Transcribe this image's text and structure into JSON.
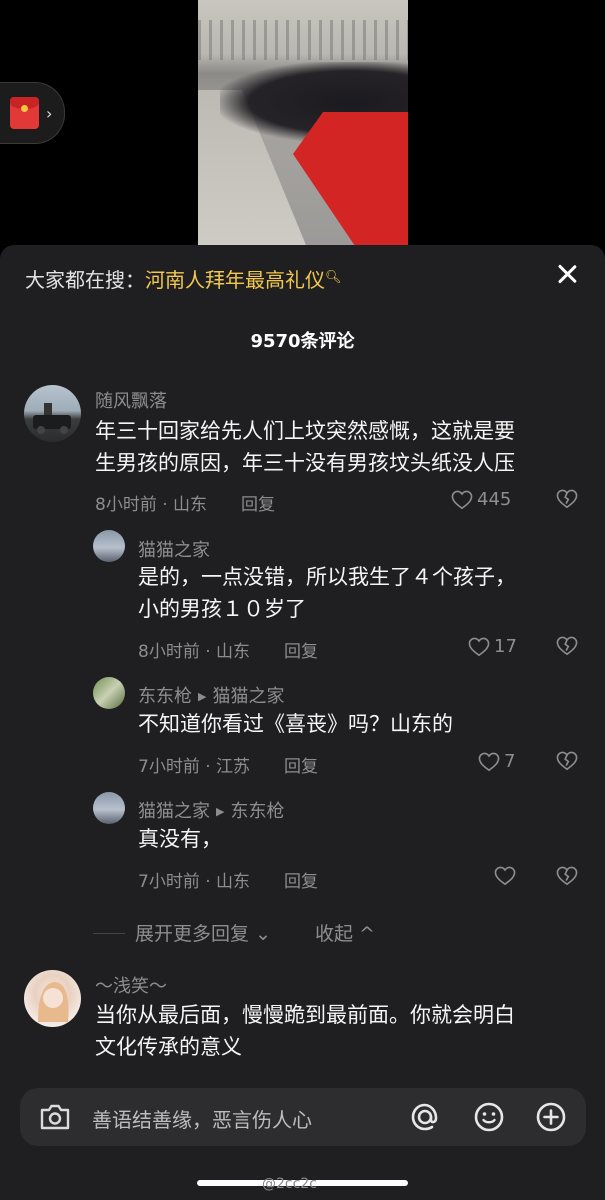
{
  "search": {
    "label": "大家都在搜：",
    "keyword": "河南人拜年最高礼仪"
  },
  "comments_count": "9570条评论",
  "comments": [
    {
      "name": "随风飘落",
      "text_lines": [
        "年三十回家给先人们上坟突然感慨，这就是要",
        "生男孩的原因，年三十没有男孩坟头纸没人压"
      ],
      "time_location": "8小时前 · 山东",
      "reply": "回复",
      "likes": "445"
    },
    {
      "name": "猫猫之家",
      "text_lines": [
        "是的，一点没错，所以我生了４个孩子，",
        "小的男孩１０岁了"
      ],
      "time_location": "8小时前 · 山东",
      "reply": "回复",
      "likes": "17"
    },
    {
      "name": "东东枪",
      "reply_to": "猫猫之家",
      "text_lines": [
        "不知道你看过《喜丧》吗？山东的"
      ],
      "time_location": "7小时前 · 江苏",
      "reply": "回复",
      "likes": "7"
    },
    {
      "name": "猫猫之家",
      "reply_to": "东东枪",
      "text_lines": [
        "真没有，"
      ],
      "time_location": "7小时前 · 山东",
      "reply": "回复",
      "likes": ""
    },
    {
      "name": "～浅笑～",
      "text_lines": [
        "当你从最后面，慢慢跪到最前面。你就会明白",
        "文化传承的意义"
      ]
    }
  ],
  "expand_replies": "展开更多回复",
  "collapse": "收起",
  "input_placeholder": "善语结善缘，恶言伤人心",
  "watermark": "@2cc2c",
  "icons": [
    "red-packet-icon",
    "search-icon",
    "close-icon",
    "heart-icon",
    "broken-heart-icon",
    "camera-icon",
    "at-icon",
    "emoji-icon",
    "plus-icon"
  ]
}
